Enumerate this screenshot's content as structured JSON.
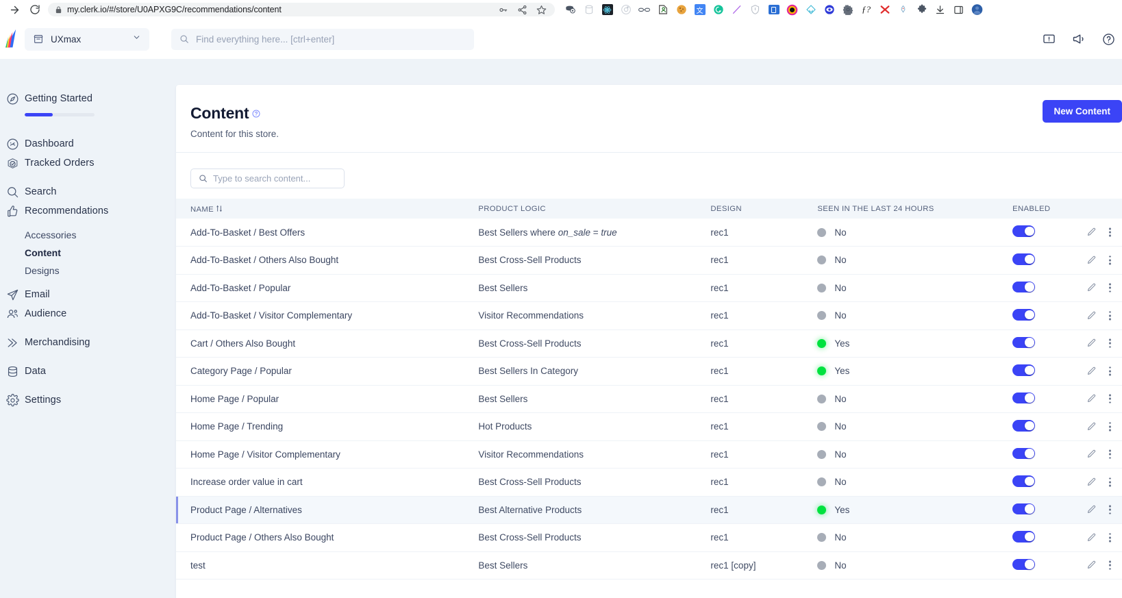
{
  "browser": {
    "url": "my.clerk.io/#/store/U0APXG9C/recommendations/content",
    "forward_icon": "forward-arrow-icon",
    "reload_icon": "reload-icon",
    "lock_icon": "lock-icon",
    "omni_actions": [
      "password-key-icon",
      "share-icon",
      "bookmark-star-icon"
    ],
    "extensions": [
      "coins-stack-icon",
      "database-icon",
      "react-devtools-icon",
      "orbit-icon",
      "link-icon",
      "person-tag-icon",
      "cookie-icon",
      "translate-icon",
      "grammarly-icon",
      "highlighter-pen-icon",
      "shield-icon",
      "window-panel-icon",
      "camera-record-icon",
      "home-diamond-icon",
      "eye-icon",
      "gear-icon",
      "function-question-icon",
      "red-x-icon",
      "rocket-icon",
      "puzzle-piece-icon",
      "download-icon",
      "sidebar-icon",
      "profile-avatar-icon"
    ]
  },
  "topbar": {
    "logo": "clerk-logo-icon",
    "store_icon": "store-icon",
    "store_name": "UXmax",
    "chevron_icon": "chevron-down-icon",
    "search_icon": "search-icon",
    "search_placeholder": "Find everything here... [ctrl+enter]",
    "right_icons": [
      "feedback-icon",
      "announcement-megaphone-icon",
      "help-circle-icon"
    ]
  },
  "sidebar": {
    "getting_started": {
      "label": "Getting Started",
      "icon": "compass-icon",
      "progress_percent": 40,
      "progress_color": "#3b44f6"
    },
    "items": [
      {
        "label": "Dashboard",
        "icon": "dashboard-gauge-icon"
      },
      {
        "label": "Tracked Orders",
        "icon": "tracked-orders-icon"
      },
      {
        "label": "Search",
        "icon": "search-icon"
      },
      {
        "label": "Recommendations",
        "icon": "thumbs-up-icon"
      },
      {
        "label": "Email",
        "icon": "paper-plane-icon"
      },
      {
        "label": "Audience",
        "icon": "people-icon"
      },
      {
        "label": "Merchandising",
        "icon": "chevrons-right-icon"
      },
      {
        "label": "Data",
        "icon": "database-stack-icon"
      },
      {
        "label": "Settings",
        "icon": "gear-icon"
      }
    ],
    "sub_items": [
      {
        "label": "Accessories",
        "active": false
      },
      {
        "label": "Content",
        "active": true
      },
      {
        "label": "Designs",
        "active": false
      }
    ]
  },
  "page": {
    "title": "Content",
    "help_icon": "help-circle-icon",
    "subtitle": "Content for this store.",
    "new_button": "New Content",
    "accent_color": "#3b44f6"
  },
  "table": {
    "search_placeholder": "Type to search content...",
    "search_icon": "search-icon",
    "columns": [
      {
        "key": "name",
        "label": "NAME",
        "sorted": true,
        "sort_icon": "sort-arrows-icon"
      },
      {
        "key": "logic",
        "label": "PRODUCT LOGIC"
      },
      {
        "key": "design",
        "label": "DESIGN"
      },
      {
        "key": "seen",
        "label": "SEEN IN THE LAST 24 HOURS"
      },
      {
        "key": "enabled",
        "label": "ENABLED"
      }
    ],
    "edit_icon": "pencil-edit-icon",
    "menu_icon": "kebab-menu-icon",
    "rows": [
      {
        "name": "Add-To-Basket / Best Offers",
        "logic_pre": "Best Sellers where ",
        "logic_em1": "on_sale",
        "logic_mid": " = ",
        "logic_em2": "true",
        "design": "rec1",
        "seen": "No",
        "seen_state": "no",
        "enabled": true,
        "highlighted": false
      },
      {
        "name": "Add-To-Basket / Others Also Bought",
        "logic": "Best Cross-Sell Products",
        "design": "rec1",
        "seen": "No",
        "seen_state": "no",
        "enabled": true,
        "highlighted": false
      },
      {
        "name": "Add-To-Basket / Popular",
        "logic": "Best Sellers",
        "design": "rec1",
        "seen": "No",
        "seen_state": "no",
        "enabled": true,
        "highlighted": false
      },
      {
        "name": "Add-To-Basket / Visitor Complementary",
        "logic": "Visitor Recommendations",
        "design": "rec1",
        "seen": "No",
        "seen_state": "no",
        "enabled": true,
        "highlighted": false
      },
      {
        "name": "Cart / Others Also Bought",
        "logic": "Best Cross-Sell Products",
        "design": "rec1",
        "seen": "Yes",
        "seen_state": "yes",
        "enabled": true,
        "highlighted": false
      },
      {
        "name": "Category Page / Popular",
        "logic": "Best Sellers In Category",
        "design": "rec1",
        "seen": "Yes",
        "seen_state": "yes",
        "enabled": true,
        "highlighted": false
      },
      {
        "name": "Home Page / Popular",
        "logic": "Best Sellers",
        "design": "rec1",
        "seen": "No",
        "seen_state": "no",
        "enabled": true,
        "highlighted": false
      },
      {
        "name": "Home Page / Trending",
        "logic": "Hot Products",
        "design": "rec1",
        "seen": "No",
        "seen_state": "no",
        "enabled": true,
        "highlighted": false
      },
      {
        "name": "Home Page / Visitor Complementary",
        "logic": "Visitor Recommendations",
        "design": "rec1",
        "seen": "No",
        "seen_state": "no",
        "enabled": true,
        "highlighted": false
      },
      {
        "name": "Increase order value in cart",
        "logic": "Best Cross-Sell Products",
        "design": "rec1",
        "seen": "No",
        "seen_state": "no",
        "enabled": true,
        "highlighted": false
      },
      {
        "name": "Product Page / Alternatives",
        "logic": "Best Alternative Products",
        "design": "rec1",
        "seen": "Yes",
        "seen_state": "yes",
        "enabled": true,
        "highlighted": true
      },
      {
        "name": "Product Page / Others Also Bought",
        "logic": "Best Cross-Sell Products",
        "design": "rec1",
        "seen": "No",
        "seen_state": "no",
        "enabled": true,
        "highlighted": false
      },
      {
        "name": "test",
        "logic": "Best Sellers",
        "design": "rec1 [copy]",
        "seen": "No",
        "seen_state": "no",
        "enabled": true,
        "highlighted": false
      }
    ]
  }
}
